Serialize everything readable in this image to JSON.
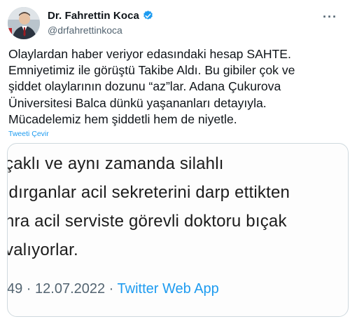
{
  "author": {
    "display_name": "Dr. Fahrettin Koca",
    "handle": "@drfahrettinkoca"
  },
  "tweet": {
    "text": "Olaylardan haber veriyor edasındaki hesap SAHTE.\nEmniyetimiz ile görüştü Takibe Aldı. Bu gibiler çok ve\nşiddet olaylarının dozunu “az”lar. Adana Çukurova\nÜniversitesi Balca dünkü yaşananları detayıyla.\nMücadelemiz hem şiddetli hem de niyetle.",
    "translate_label": "Tweeti Çevir",
    "more_label": "···"
  },
  "embedded_card": {
    "lines": [
      "çaklı ve aynı zamanda silahlı",
      "ldırganlar acil sekreterini darp ettikten",
      "nra acil serviste görevli doktoru bıçak",
      "valıyorlar."
    ],
    "meta_prefix": "49 · 12.07.2022 · ",
    "meta_app": "Twitter Web App"
  },
  "colors": {
    "accent": "#1d9bf0",
    "muted": "#536471",
    "text": "#0f1419"
  },
  "icons": {
    "verified": "verified-badge-icon",
    "more": "more-options-icon"
  }
}
